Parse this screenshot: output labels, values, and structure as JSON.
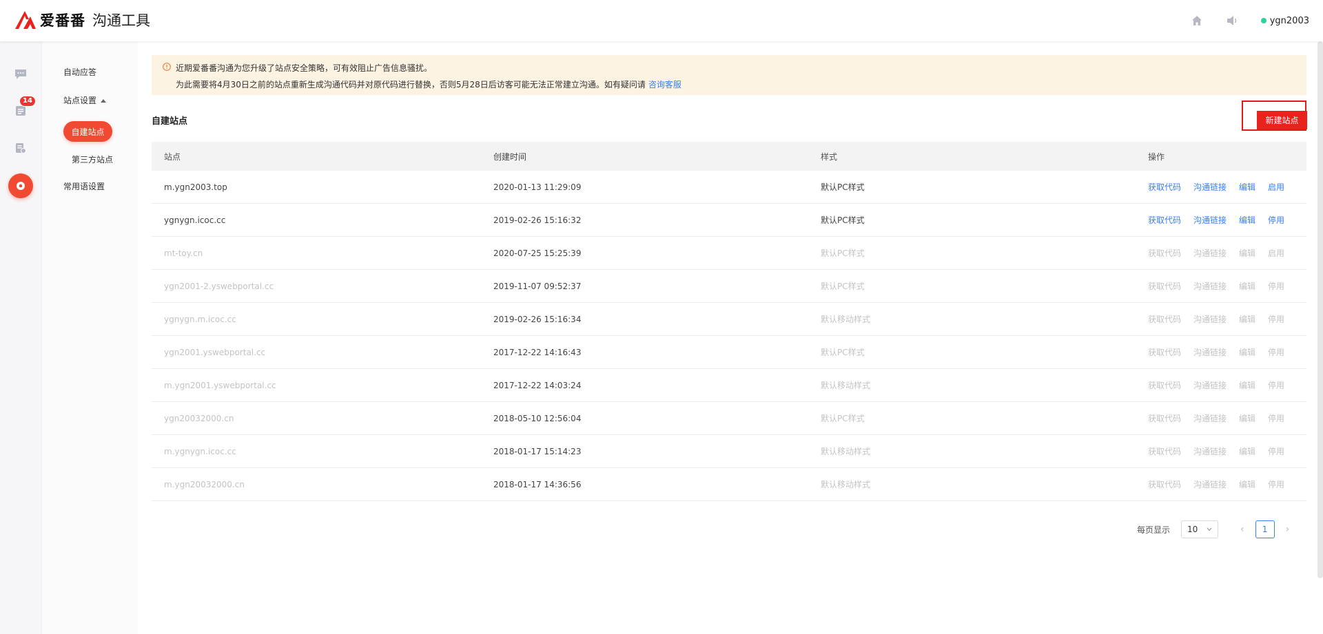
{
  "header": {
    "brand": "爱番番",
    "product": "沟通工具",
    "username": "ygn2003",
    "icons": {
      "home": "home-icon",
      "speaker": "speaker-icon"
    }
  },
  "rail": {
    "badge": "14",
    "icons": [
      "chat-icon",
      "list-icon",
      "report-icon",
      "settings-icon"
    ]
  },
  "subnav": {
    "auto_reply": "自动应答",
    "site_settings": "站点设置",
    "self_built": "自建站点",
    "third_party": "第三方站点",
    "phrases": "常用语设置"
  },
  "notice": {
    "line1": "近期爱番番沟通为您升级了站点安全策略，可有效阻止广告信息骚扰。",
    "line2": "为此需要将4月30日之前的站点重新生成沟通代码并对原代码进行替换，否则5月28日后访客可能无法正常建立沟通。如有疑问请",
    "link": "咨询客服"
  },
  "section": {
    "title": "自建站点",
    "new_button": "新建站点"
  },
  "table": {
    "headers": [
      "站点",
      "创建时间",
      "样式",
      "操作"
    ],
    "rows": [
      {
        "site": "m.ygn2003.top",
        "time": "2020-01-13 11:29:09",
        "style": "默认PC样式",
        "ops": [
          "获取代码",
          "沟通链接",
          "编辑",
          "启用"
        ],
        "state": "enabled"
      },
      {
        "site": "ygnygn.icoc.cc",
        "time": "2019-02-26 15:16:32",
        "style": "默认PC样式",
        "ops": [
          "获取代码",
          "沟通链接",
          "编辑",
          "停用"
        ],
        "state": "enabled"
      },
      {
        "site": "mt-toy.cn",
        "time": "2020-07-25 15:25:39",
        "style": "默认PC样式",
        "ops": [
          "获取代码",
          "沟通链接",
          "编辑",
          "启用"
        ],
        "state": "disabled"
      },
      {
        "site": "ygn2001-2.yswebportal.cc",
        "time": "2019-11-07 09:52:37",
        "style": "默认PC样式",
        "ops": [
          "获取代码",
          "沟通链接",
          "编辑",
          "停用"
        ],
        "state": "disabled"
      },
      {
        "site": "ygnygn.m.icoc.cc",
        "time": "2019-02-26 15:16:34",
        "style": "默认移动样式",
        "ops": [
          "获取代码",
          "沟通链接",
          "编辑",
          "停用"
        ],
        "state": "disabled"
      },
      {
        "site": "ygn2001.yswebportal.cc",
        "time": "2017-12-22 14:16:43",
        "style": "默认PC样式",
        "ops": [
          "获取代码",
          "沟通链接",
          "编辑",
          "停用"
        ],
        "state": "disabled"
      },
      {
        "site": "m.ygn2001.yswebportal.cc",
        "time": "2017-12-22 14:03:24",
        "style": "默认移动样式",
        "ops": [
          "获取代码",
          "沟通链接",
          "编辑",
          "停用"
        ],
        "state": "disabled"
      },
      {
        "site": "ygn20032000.cn",
        "time": "2018-05-10 12:56:04",
        "style": "默认PC样式",
        "ops": [
          "获取代码",
          "沟通链接",
          "编辑",
          "停用"
        ],
        "state": "disabled"
      },
      {
        "site": "m.ygnygn.icoc.cc",
        "time": "2018-01-17 15:14:23",
        "style": "默认移动样式",
        "ops": [
          "获取代码",
          "沟通链接",
          "编辑",
          "停用"
        ],
        "state": "disabled"
      },
      {
        "site": "m.ygn20032000.cn",
        "time": "2018-01-17 14:36:56",
        "style": "默认移动样式",
        "ops": [
          "获取代码",
          "沟通链接",
          "编辑",
          "停用"
        ],
        "state": "disabled"
      }
    ]
  },
  "pager": {
    "per_page_label": "每页显示",
    "page_size": "10",
    "current_page": "1"
  },
  "colors": {
    "brand": "#f04b32",
    "link": "#3a7ef0",
    "notice_bg": "#fcf3e3"
  }
}
